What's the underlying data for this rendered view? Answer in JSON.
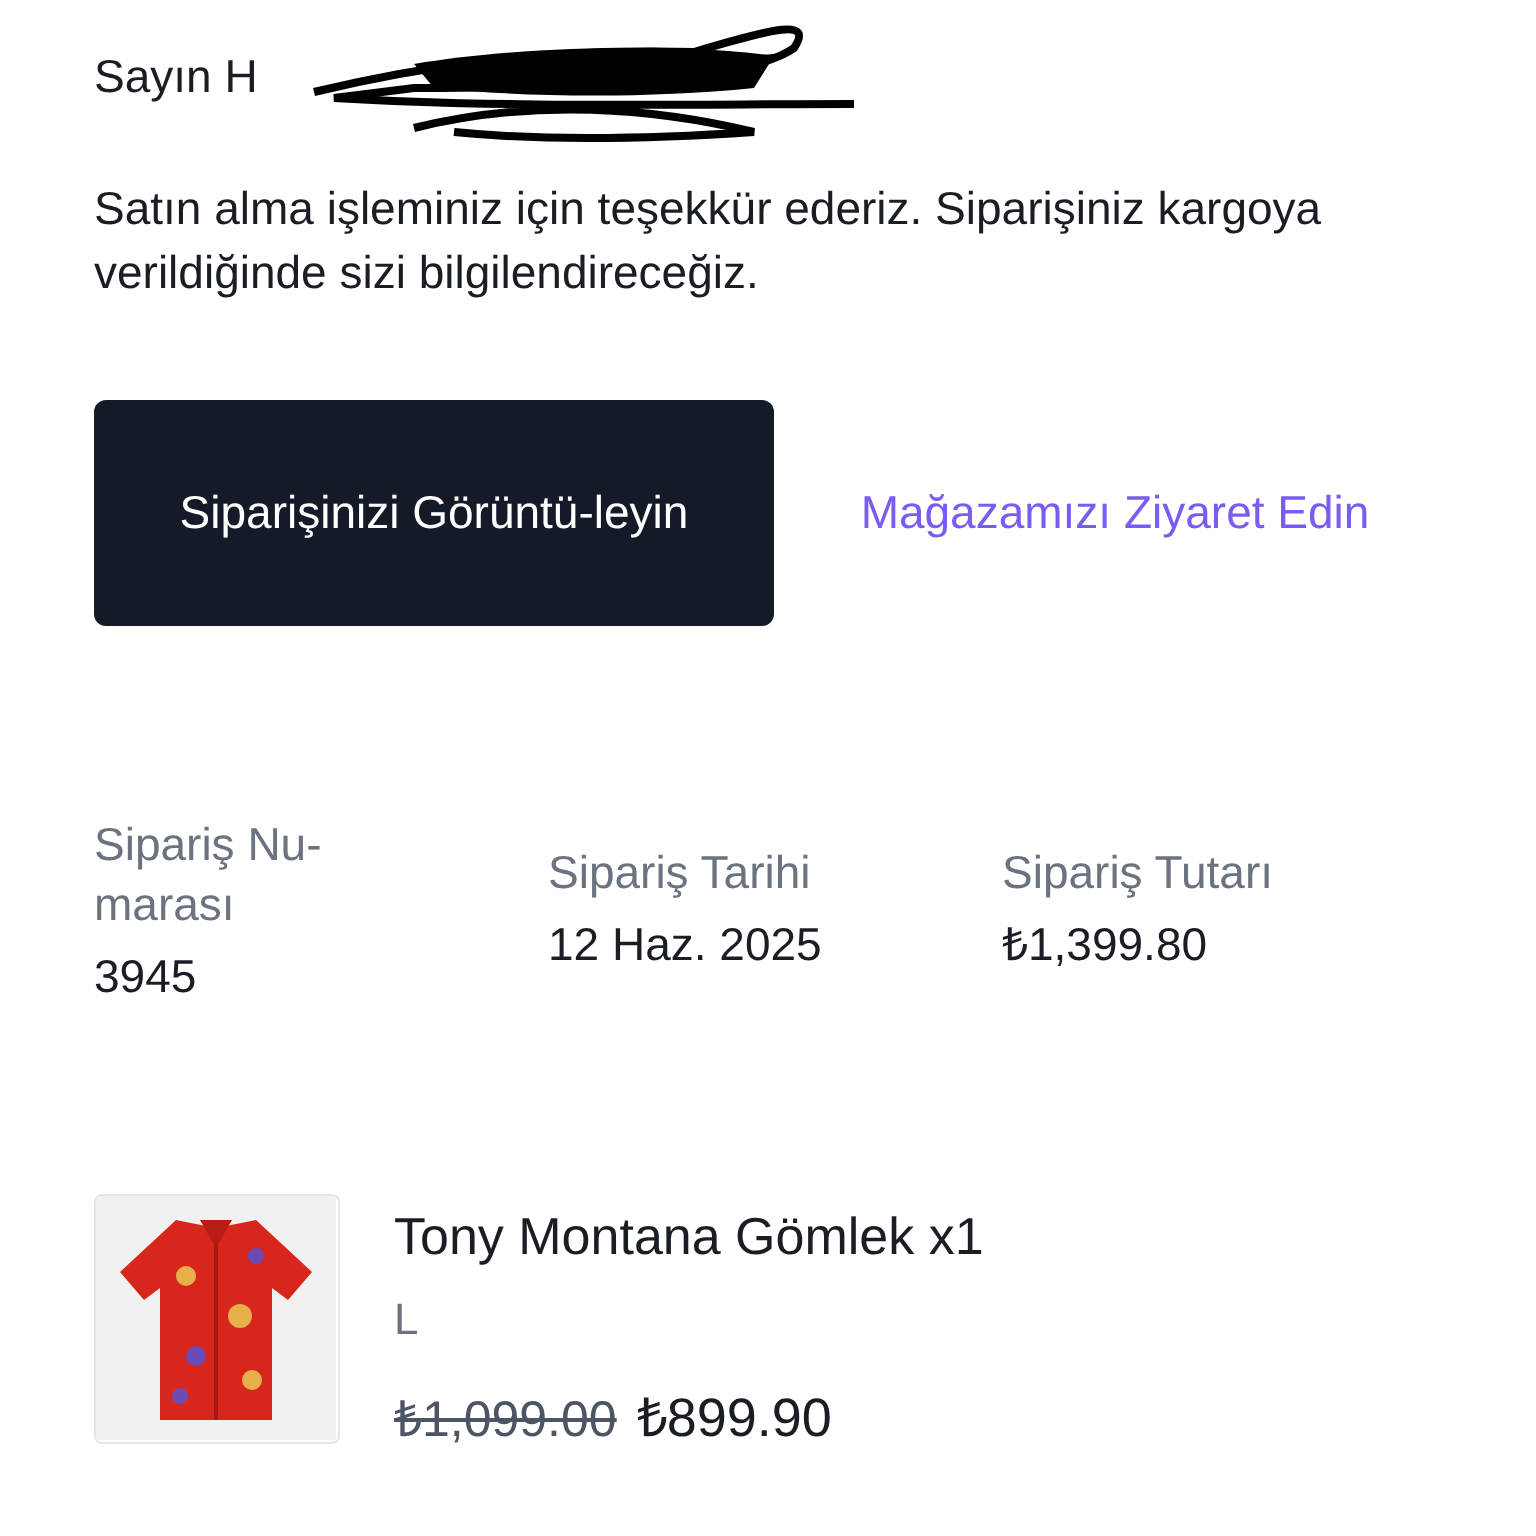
{
  "greeting": "Sayın H",
  "message": "Satın alma işleminiz için teşekkür ederiz. Siparişiniz kargoya verildiğinde sizi bilgilendireceğiz.",
  "view_order_button": "Siparişinizi Görüntü-leyin",
  "visit_store_link": "Mağazamızı Ziyaret Edin",
  "summary": [
    {
      "label": "Sipariş Nu-marası",
      "value": "3945"
    },
    {
      "label": "Sipariş Tarihi",
      "value": "12 Haz. 2025"
    },
    {
      "label": "Sipariş Tutarı",
      "value": "₺1,399.80"
    }
  ],
  "items": [
    {
      "kind": "picture",
      "title": "Tony Montana Gömlek x1",
      "variant": "L",
      "old_price": "₺1,099.00",
      "price": "₺899.90"
    }
  ]
}
